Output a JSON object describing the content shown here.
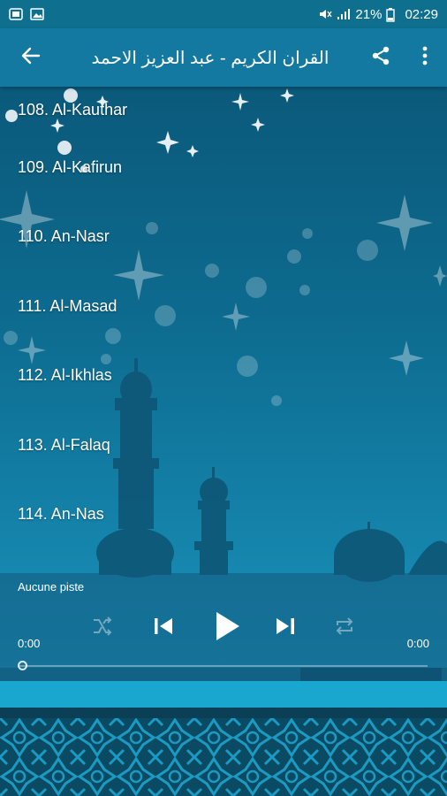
{
  "status_bar": {
    "signal": "21%",
    "time": "02:29"
  },
  "app_bar": {
    "title": "القران الكريم - عبد العزيز الاحمد"
  },
  "surahs": [
    "108. Al-Kauthar",
    "109. Al-Kafirun",
    "110. An-Nasr",
    "111. Al-Masad",
    "112. Al-Ikhlas",
    "113. Al-Falaq",
    "114. An-Nas"
  ],
  "player": {
    "track_label": "Aucune piste",
    "elapsed": "0:00",
    "duration": "0:00",
    "progress": 0
  },
  "colors": {
    "app_bar": "#1479a0",
    "status_bar": "#0f6f8f",
    "accent_band": "#1aa7cf"
  }
}
